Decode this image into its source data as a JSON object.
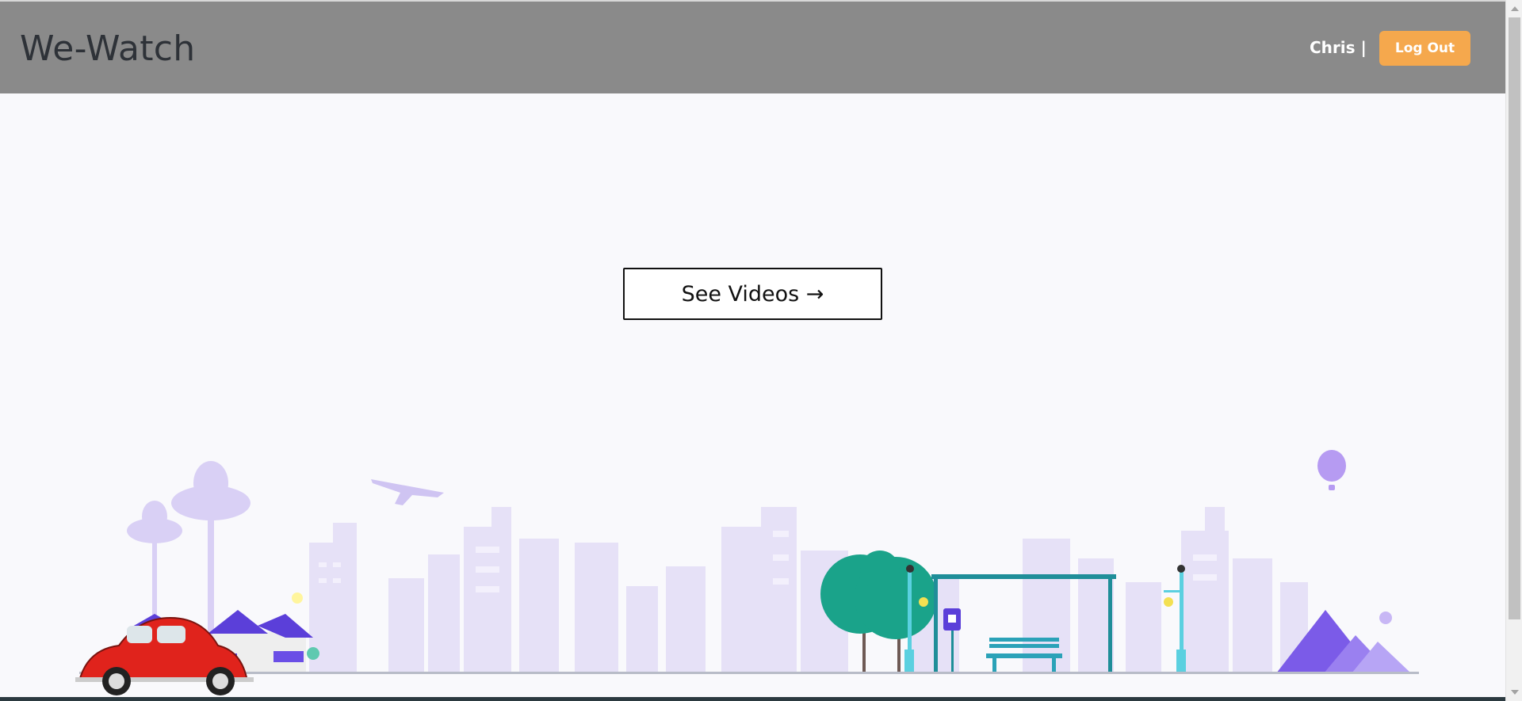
{
  "navbar": {
    "brand": "We-Watch",
    "user": "Chris |",
    "logout_label": "Log Out",
    "bg_color": "#8a8a8a",
    "logout_color": "#f5a84d"
  },
  "main": {
    "see_videos_label": "See Videos →"
  },
  "illustration": {
    "icons": [
      "palm-trees-icon",
      "airplane-icon",
      "city-skyline-icon",
      "houses-icon",
      "red-car-icon",
      "tree-icon",
      "bus-stop-icon",
      "street-lamp-icon",
      "bench-icon",
      "hot-air-balloon-icon",
      "pyramids-icon"
    ]
  }
}
